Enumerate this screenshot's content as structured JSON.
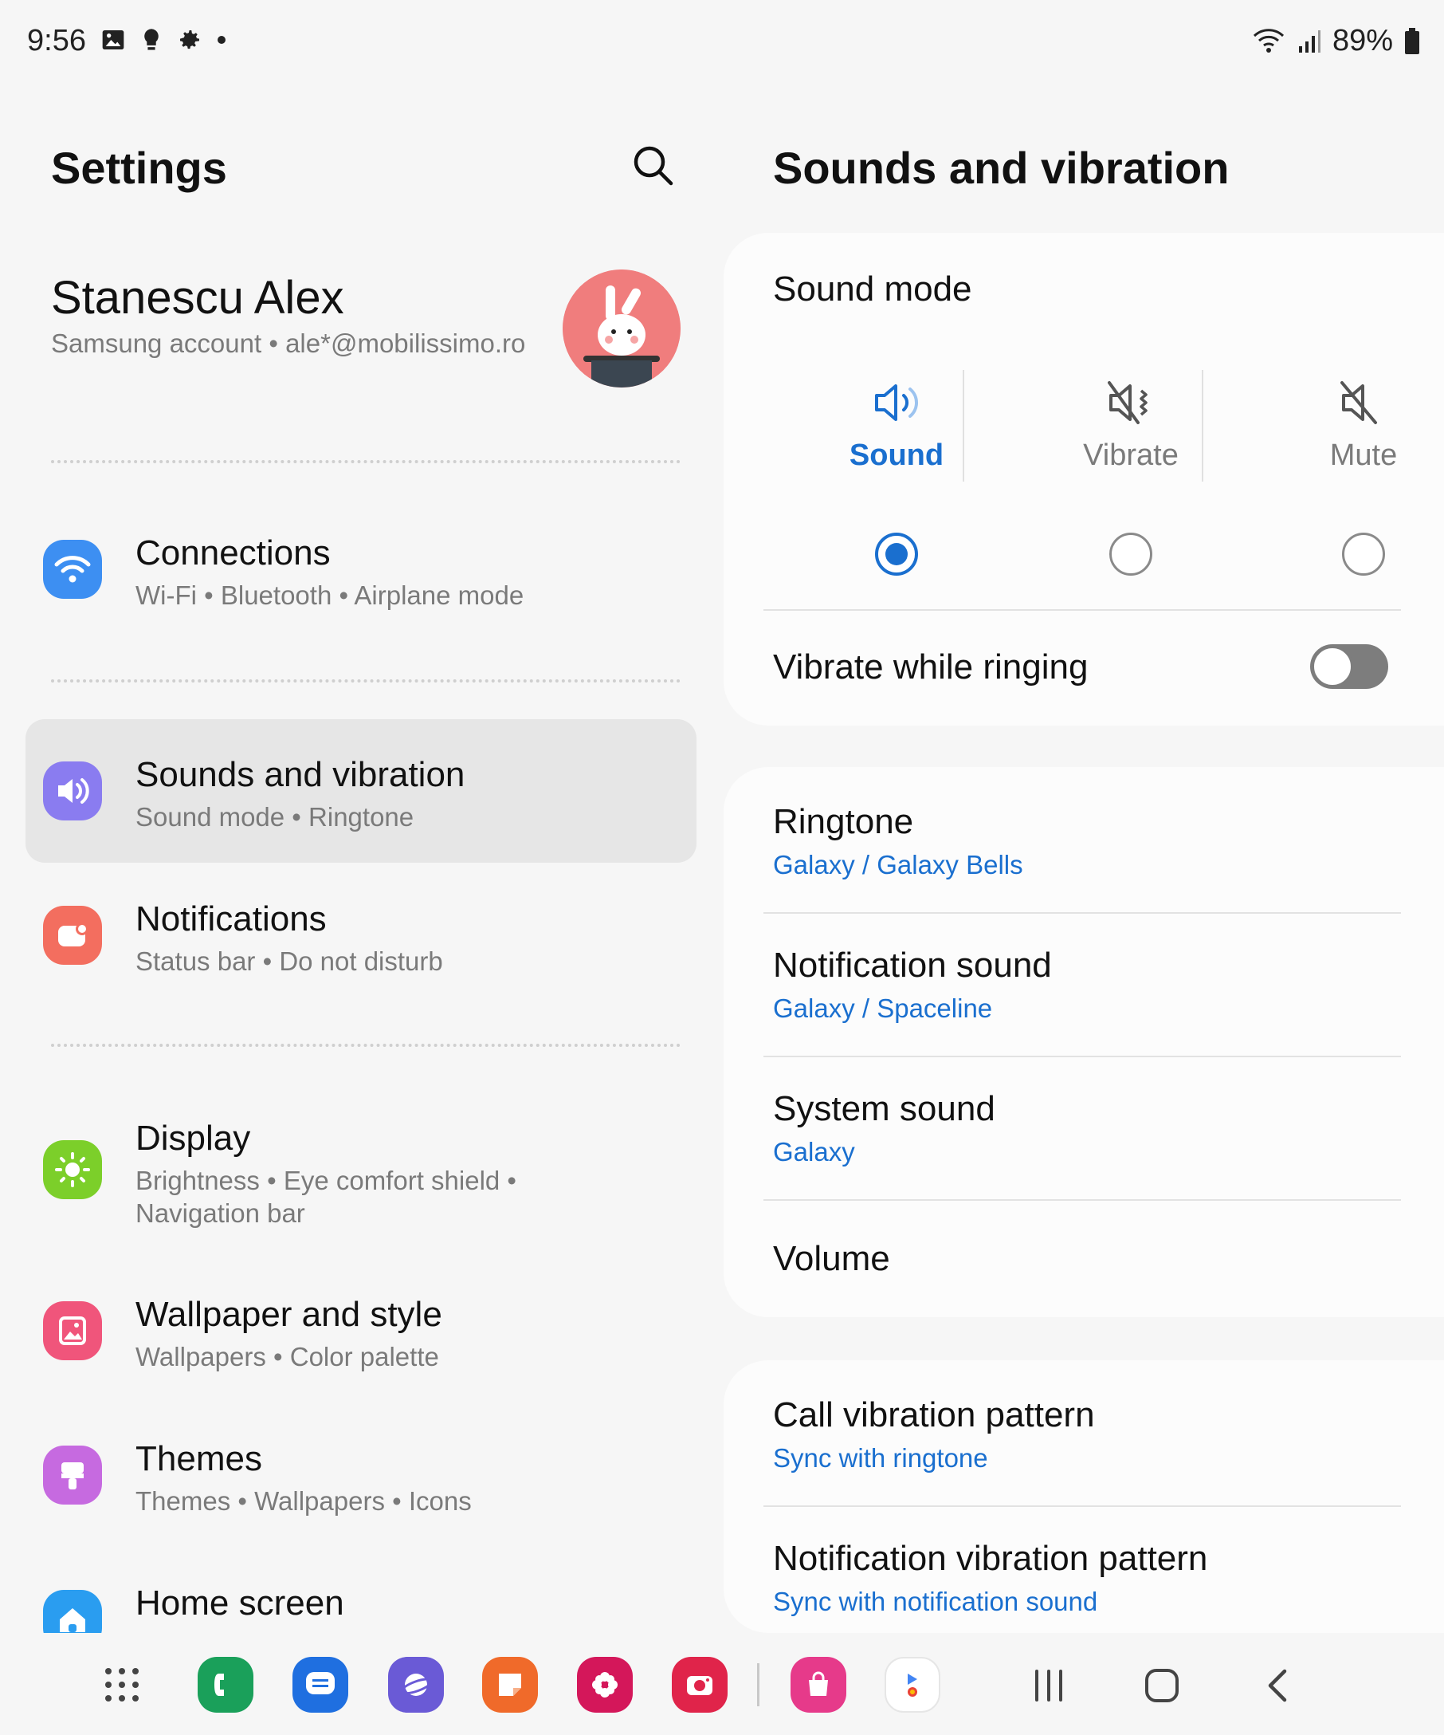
{
  "status_bar": {
    "time": "9:56",
    "battery": "89%",
    "left_icons": [
      "gallery-icon",
      "bulb-icon",
      "settings-gear-icon",
      "dot-icon"
    ],
    "right_icons": [
      "wifi-icon",
      "signal-icon",
      "battery-icon"
    ]
  },
  "left_pane": {
    "title": "Settings",
    "profile": {
      "name": "Stanescu Alex",
      "account_type": "Samsung account",
      "email": "ale*@mobilissimo.ro"
    },
    "items": [
      {
        "title": "Connections",
        "subs": [
          "Wi-Fi",
          "Bluetooth",
          "Airplane mode"
        ],
        "icon": "wifi-icon",
        "color": "#3d8ff2"
      },
      {
        "title": "Sounds and vibration",
        "subs": [
          "Sound mode",
          "Ringtone"
        ],
        "icon": "speaker-icon",
        "color": "#8a7cf0",
        "active": true
      },
      {
        "title": "Notifications",
        "subs": [
          "Status bar",
          "Do not disturb"
        ],
        "icon": "notification-icon",
        "color": "#f36e5f"
      },
      {
        "title": "Display",
        "subs": [
          "Brightness",
          "Eye comfort shield",
          "Navigation bar"
        ],
        "icon": "sun-icon",
        "color": "#7ccf2a"
      },
      {
        "title": "Wallpaper and style",
        "subs": [
          "Wallpapers",
          "Color palette"
        ],
        "icon": "picture-icon",
        "color": "#f0557b"
      },
      {
        "title": "Themes",
        "subs": [
          "Themes",
          "Wallpapers",
          "Icons"
        ],
        "icon": "brush-icon",
        "color": "#c66ae0"
      },
      {
        "title": "Home screen",
        "subs": [],
        "icon": "home-icon",
        "color": "#2a9df0"
      }
    ]
  },
  "right_pane": {
    "title": "Sounds and vibration",
    "sound_mode": {
      "label": "Sound mode",
      "options": [
        {
          "label": "Sound",
          "icon": "speaker-on-icon",
          "selected": true
        },
        {
          "label": "Vibrate",
          "icon": "vibrate-icon",
          "selected": false
        },
        {
          "label": "Mute",
          "icon": "mute-icon",
          "selected": false
        }
      ]
    },
    "vibrate_while_ringing": {
      "label": "Vibrate while ringing",
      "enabled": false
    },
    "sounds": [
      {
        "title": "Ringtone",
        "value": "Galaxy / Galaxy Bells"
      },
      {
        "title": "Notification sound",
        "value": "Galaxy / Spaceline"
      },
      {
        "title": "System sound",
        "value": "Galaxy"
      },
      {
        "title": "Volume",
        "value": ""
      }
    ],
    "vibration": [
      {
        "title": "Call vibration pattern",
        "value": "Sync with ringtone"
      },
      {
        "title": "Notification vibration pattern",
        "value": "Sync with notification sound"
      }
    ]
  },
  "dock": {
    "apps": [
      {
        "icon": "app-drawer-icon",
        "color": ""
      },
      {
        "icon": "phone-app-icon",
        "color": "#1aa05a"
      },
      {
        "icon": "messages-app-icon",
        "color": "#1f6fe0"
      },
      {
        "icon": "internet-app-icon",
        "color": "#6a5ad6"
      },
      {
        "icon": "notes-app-icon",
        "color": "#f06a2a"
      },
      {
        "icon": "gallery-app-icon",
        "color": "#d4175a"
      },
      {
        "icon": "camera-app-icon",
        "color": "#e0244a"
      },
      {
        "icon": "store-app-icon",
        "color": "#e63a8a"
      },
      {
        "icon": "google-folder-icon",
        "color": "#ffffff"
      }
    ],
    "nav": [
      "recents-icon",
      "home-nav-icon",
      "back-icon"
    ]
  }
}
